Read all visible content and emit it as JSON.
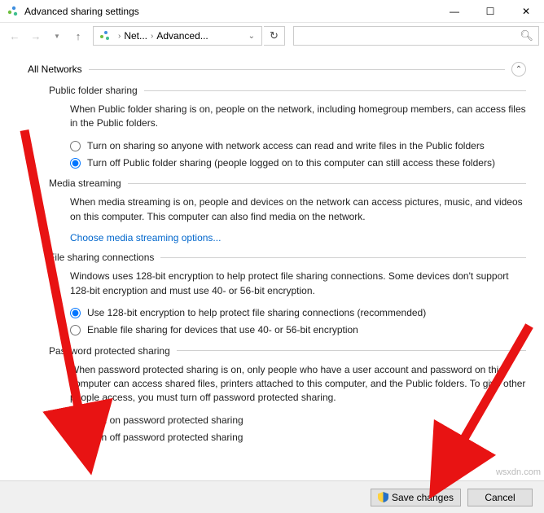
{
  "window": {
    "title": "Advanced sharing settings",
    "minimize": "—",
    "maximize": "☐",
    "close": "✕"
  },
  "nav": {
    "back": "←",
    "forward": "→",
    "up": "↑",
    "bc_seg1": "Net...",
    "bc_seg2": "Advanced...",
    "refresh": "↻",
    "search_placeholder": ""
  },
  "sections": {
    "network": {
      "title": "All Networks"
    },
    "pfs": {
      "title": "Public folder sharing",
      "desc": "When Public folder sharing is on, people on the network, including homegroup members, can access files in the Public folders.",
      "opt1": "Turn on sharing so anyone with network access can read and write files in the Public folders",
      "opt2": "Turn off Public folder sharing (people logged on to this computer can still access these folders)"
    },
    "media": {
      "title": "Media streaming",
      "desc": "When media streaming is on, people and devices on the network can access pictures, music, and videos on this computer. This computer can also find media on the network.",
      "link": "Choose media streaming options..."
    },
    "fsc": {
      "title": "File sharing connections",
      "desc": "Windows uses 128-bit encryption to help protect file sharing connections. Some devices don't support 128-bit encryption and must use 40- or 56-bit encryption.",
      "opt1": "Use 128-bit encryption to help protect file sharing connections (recommended)",
      "opt2": "Enable file sharing for devices that use 40- or 56-bit encryption"
    },
    "pps": {
      "title": "Password protected sharing",
      "desc": "When password protected sharing is on, only people who have a user account and password on this computer can access shared files, printers attached to this computer, and the Public folders. To give other people access, you must turn off password protected sharing.",
      "opt1": "Turn on password protected sharing",
      "opt2": "Turn off password protected sharing"
    }
  },
  "footer": {
    "save": "Save changes",
    "cancel": "Cancel"
  },
  "watermark": "wsxdn.com"
}
